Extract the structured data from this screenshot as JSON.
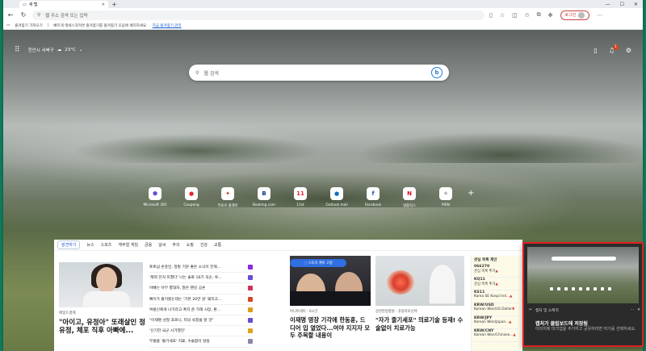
{
  "browser": {
    "tab_title": "새 탭",
    "new_tab_symbol": "+",
    "window_controls": [
      "—",
      "☐",
      "✕"
    ],
    "address_placeholder": "웹 주소 검색 또는 입력",
    "login_label": "로그인"
  },
  "favorites_bar": {
    "label": "즐겨찾기 가져오기",
    "message": "빠르게 액세스하려면 즐겨찾기를 즐겨찾기 모음에 배치하세요.",
    "link": "지금 즐겨찾기 관리"
  },
  "newtab": {
    "location": "천안시 서북구",
    "temperature": "23°C",
    "notification_count": "1",
    "search_placeholder": "웹 검색",
    "bing_letter": "b",
    "quick_links": [
      {
        "label": "Microsoft 365",
        "icon": "⬢",
        "color": "#6a4bd6"
      },
      {
        "label": "Coupang",
        "icon": "●",
        "color": "#e02a2a"
      },
      {
        "label": "무료로 플레이",
        "icon": "✦",
        "color": "#c0391b"
      },
      {
        "label": "Booking.com",
        "icon": "B",
        "color": "#0b3b8c"
      },
      {
        "label": "11st",
        "icon": "11",
        "color": "#e8212e"
      },
      {
        "label": "Outlook mail",
        "icon": "●",
        "color": "#0f6cbd"
      },
      {
        "label": "Facebook",
        "icon": "f",
        "color": "#1f4fa3"
      },
      {
        "label": "넷플릭스",
        "icon": "N",
        "color": "#e50914"
      },
      {
        "label": "MSN",
        "icon": "✧",
        "color": "#333333"
      }
    ]
  },
  "feed": {
    "tabs": [
      "발견하기",
      "뉴스",
      "스포츠",
      "캐주얼 게임",
      "금융",
      "날씨",
      "주의",
      "쇼핑",
      "건강",
      "교통"
    ],
    "main_source": "매일드경제",
    "main_headline": "\"아이고, 유정아\" 또래살인 정유정, 체포 직후 아빠에...",
    "list": [
      {
        "text": "토트넘 손흥민, 정말 기분 좋은 소식이 전해...",
        "color": "#8a2be2"
      },
      {
        "text": "'재력 전처 미쳤다' 나는 솔로 16기 옥순, 루...",
        "color": "#6a4bd6"
      },
      {
        "text": "아빠는 아무 향대자, 말은 팬싱 공손",
        "color": "#cc3355"
      },
      {
        "text": "뼈이가 즐거웠는데는 '기본 20만 원' 돼지고...",
        "color": "#d24726"
      },
      {
        "text": "여름신에게 나가라고 폭지 준 가해 사장, 환...",
        "color": "#e09a1b"
      },
      {
        "text": "\"이재명 성질 포르니, 피의 숙청을 할 것\"",
        "color": "#6a4bd6"
      },
      {
        "text": "'신기한 국군 시가행진'",
        "color": "#e0a21b"
      },
      {
        "text": "부룸룸 '즐기세포' 지료, 수술없이 달릴",
        "color": "#8888aa"
      }
    ],
    "story_button": "스토리 계속 고정",
    "card2_source": "머니투데이 · 6시간",
    "card2_headline": "이재명 영장 기각에 한동훈, 드디어 입 열었다...여야 지지자 모두 주목할 내용이",
    "card3_source": "장면한방병원 · 후원자로선택",
    "card3_headline": "\"자가 줄기세포\" 의료기술 등재! 수술없이 치료가능",
    "market_title": "관심 목록 제안",
    "market_items": [
      {
        "name": "066270",
        "desc": "관심 목록 추가",
        "change": "▲"
      },
      {
        "name": "KQ11",
        "desc": "관심 목록 추가",
        "change": "▲"
      },
      {
        "name": "KS11",
        "desc": "Korea SE Kospi Ind...",
        "change": "▲"
      },
      {
        "name": "KRW/USD",
        "desc": "Korean Won/US Dollar",
        "change": "▼"
      },
      {
        "name": "KRW/JPY",
        "desc": "Korean Won/Japan...",
        "change": "▲"
      },
      {
        "name": "KRW/CNY",
        "desc": "Korean Won/Chinese...",
        "change": "▲"
      }
    ]
  },
  "toast": {
    "app": "캡처 및 스케치",
    "more": "···",
    "close": "✕",
    "title": "캡처가 클립보드에 저장됨",
    "body": "이미지에 마크업을 추가하고 공유하려면 여기를 선택하세요."
  }
}
